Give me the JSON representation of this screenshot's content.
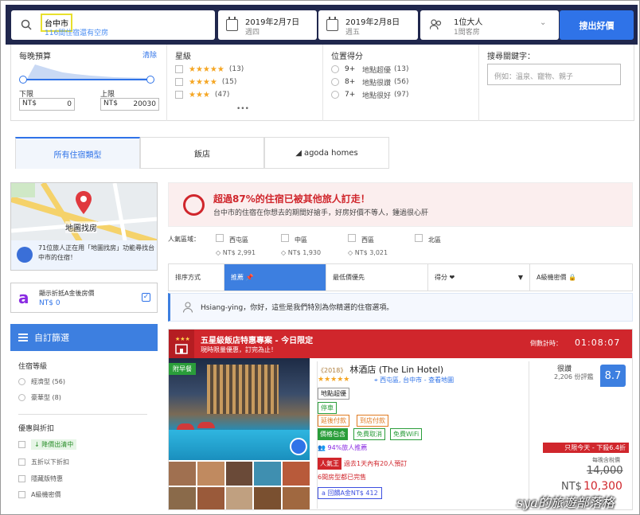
{
  "search": {
    "destination": "台中市",
    "destination_sub": "116間住宿還有空房",
    "checkin_date": "2019年2月7日",
    "checkin_day": "週四",
    "checkout_date": "2019年2月8日",
    "checkout_day": "週五",
    "occupancy": "1位大人",
    "rooms": "1間客房",
    "button": "搜出好價"
  },
  "filters": {
    "budget_title": "每晚預算",
    "clear": "清除",
    "min_label": "下限",
    "max_label": "上限",
    "currency": "NT$",
    "min_value": "0",
    "max_value": "20030",
    "star_title": "星級",
    "star_options": [
      {
        "stars": "★★★★★",
        "count": "(13)"
      },
      {
        "stars": "★★★★",
        "count": "(15)"
      },
      {
        "stars": "★★★",
        "count": "(47)"
      }
    ],
    "more": "•••",
    "location_title": "位置得分",
    "location_options": [
      {
        "score": "9+",
        "label": "地點超優",
        "count": "(13)"
      },
      {
        "score": "8+",
        "label": "地點很讚",
        "count": "(56)"
      },
      {
        "score": "7+",
        "label": "地點很好",
        "count": "(97)"
      }
    ],
    "keyword_title": "搜尋關鍵字：",
    "keyword_placeholder": "例如：溫泉、寵物、親子"
  },
  "tabs": [
    {
      "label": "所有住宿類型"
    },
    {
      "label": "飯店"
    },
    {
      "label": "agoda homes"
    }
  ],
  "left": {
    "map_label": "地圖找房",
    "map_tip": "71位旅人正在用「地圖找房」功能尋找台中市的住宿！",
    "agoda_gold_title": "顯示折抵A金後房價",
    "agoda_gold_value": "NT$ 0",
    "custom_filter": "自訂篩選",
    "lodging_level_title": "住宿等級",
    "lodging_levels": [
      {
        "label": "經濟型 (56)"
      },
      {
        "label": "豪華型 (8)"
      }
    ],
    "deals_title": "優惠與折扣",
    "deals": [
      {
        "label": "降價出清中"
      },
      {
        "label": "五折以下折扣"
      },
      {
        "label": "隱藏版特惠"
      },
      {
        "label": "A級機密價"
      }
    ]
  },
  "alert": {
    "title": "超過87%的住宿已被其他旅人訂走！",
    "text": "台中市的住宿在你想去的期間好搶手，好房好價不等人，鍾過很心肝"
  },
  "areas": {
    "label": "人氣區域：",
    "items": [
      {
        "name": "西屯區",
        "price": "NT$ 2,991"
      },
      {
        "name": "中區",
        "price": "NT$ 1,930"
      },
      {
        "name": "西區",
        "price": "NT$ 3,021"
      },
      {
        "name": "北區",
        "price": ""
      }
    ]
  },
  "sort": {
    "label": "排序方式",
    "options": [
      "推薦 📌",
      "最低價優先",
      "得分 ❤",
      "A級機密價 🔒"
    ]
  },
  "greeting": "Hsiang-ying，你好，這些是我們特別為你精選的住宿選項。",
  "hotel": {
    "promo_title": "五星級飯店特惠專案 - 今日限定",
    "promo_sub": "現時限量優惠，訂完為止！",
    "countdown_label": "倒數計時：",
    "countdown": "01:08:07",
    "breakfast_badge": "附早餐",
    "year": "2018",
    "name": "林酒店 (The Lin Hotel)",
    "stars": "★★★★★",
    "location": "西屯區, 台中市 - 查看地圖",
    "tag_location": "地點超優",
    "tag_parking": "停車",
    "tag_late_pay": "延後付款",
    "tag_pay_at_hotel": "到店付款",
    "tag_included": "價格包含",
    "tag_free_cancel": "免費取消",
    "tag_wifi": "免費WiFi",
    "recommend": "94%旅人推薦",
    "hot_label": "人氣王",
    "hot_text": "過去1天內有20人預訂",
    "sold_out": "6間房型都已完售",
    "cashback": "回饋A金NT$ 412",
    "rating_label": "很讚",
    "rating_count": "2,206 份評鑑",
    "rating": "8.7",
    "today_deal": "只限今天 - 下殺6.4折",
    "per_night": "每晚含稅價",
    "old_price": "14,000",
    "currency": "NT$",
    "new_price": "10,300"
  },
  "watermark": "sya的旅遊部落格"
}
